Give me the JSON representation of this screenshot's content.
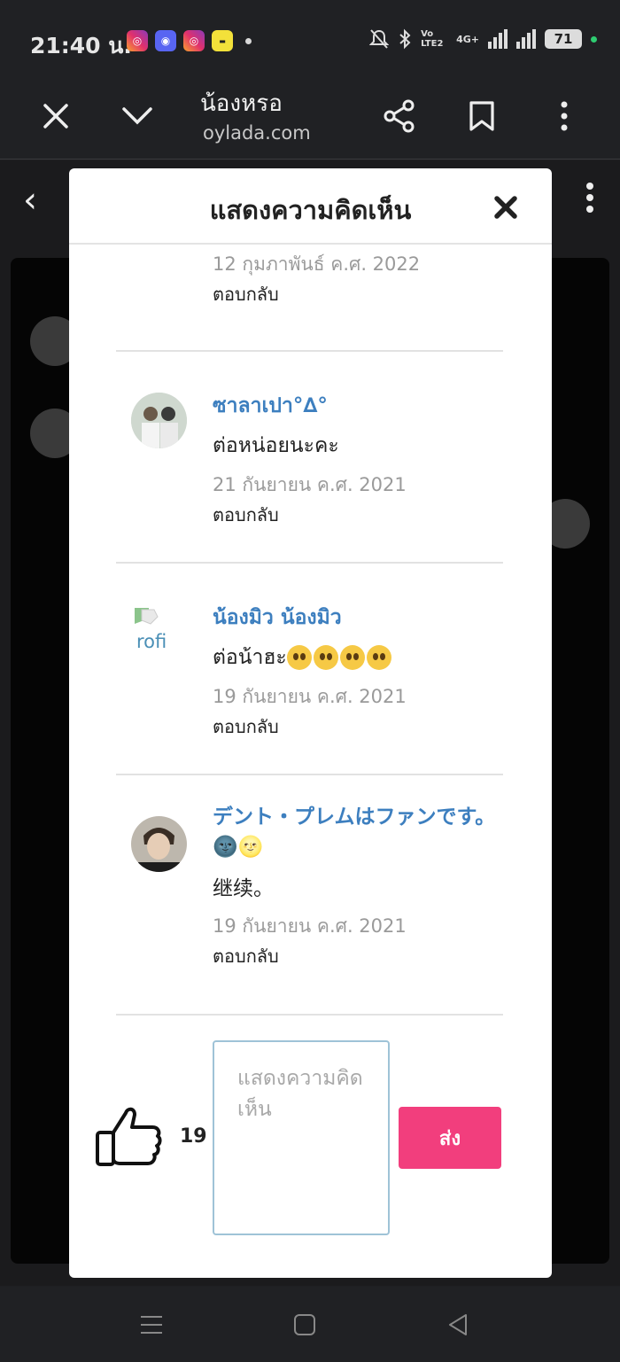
{
  "status_bar": {
    "time": "21:40 น.",
    "battery": "71",
    "network": "4G+",
    "volte": "Vo LTE2"
  },
  "browser": {
    "title": "น้องหรอ",
    "url": "oylada.com"
  },
  "modal": {
    "title": "แสดงความคิดเห็น",
    "comments": [
      {
        "name": "",
        "text": "",
        "date": "12 กุมภาพันธ์ ค.ศ. 2022",
        "reply": "ตอบกลับ"
      },
      {
        "name": "ซาลาเปา°∆°",
        "text": "ต่อหน่อยนะคะ",
        "date": "21 กันยายน ค.ศ. 2021",
        "reply": "ตอบกลับ"
      },
      {
        "name": "น้องมิว น้องมิว",
        "text": "ต่อน้าฮะ",
        "date": "19 กันยายน ค.ศ. 2021",
        "reply": "ตอบกลับ",
        "avatar_alt": "rofi"
      },
      {
        "name": "デント・プレムはファンです。🌚🌝",
        "text": "继续。",
        "date": "19 กันยายน ค.ศ. 2021",
        "reply": "ตอบกลับ"
      }
    ],
    "like_count": "19",
    "comment_placeholder": "แสดงความคิดเห็น",
    "send_label": "ส่ง"
  },
  "colors": {
    "accent": "#f23e7d",
    "name_blue": "#3d7fbf",
    "background_dark": "#202124"
  }
}
